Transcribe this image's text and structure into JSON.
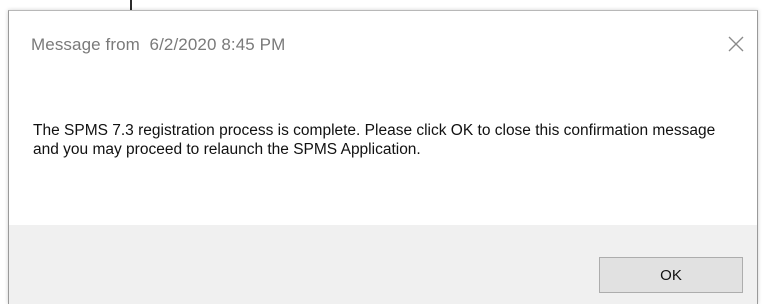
{
  "dialog": {
    "title": "Message from  6/2/2020 8:45 PM",
    "close_icon": "close-icon",
    "message": "The SPMS 7.3 registration process is complete. Please click OK to close this confirmation message and you may proceed to relaunch the SPMS Application.",
    "ok_label": "OK"
  },
  "colors": {
    "title_text": "#7a7a7a",
    "message_text": "#111111",
    "footer_bg": "#f0f0f0",
    "button_bg": "#e1e1e1",
    "button_border": "#adadad"
  }
}
